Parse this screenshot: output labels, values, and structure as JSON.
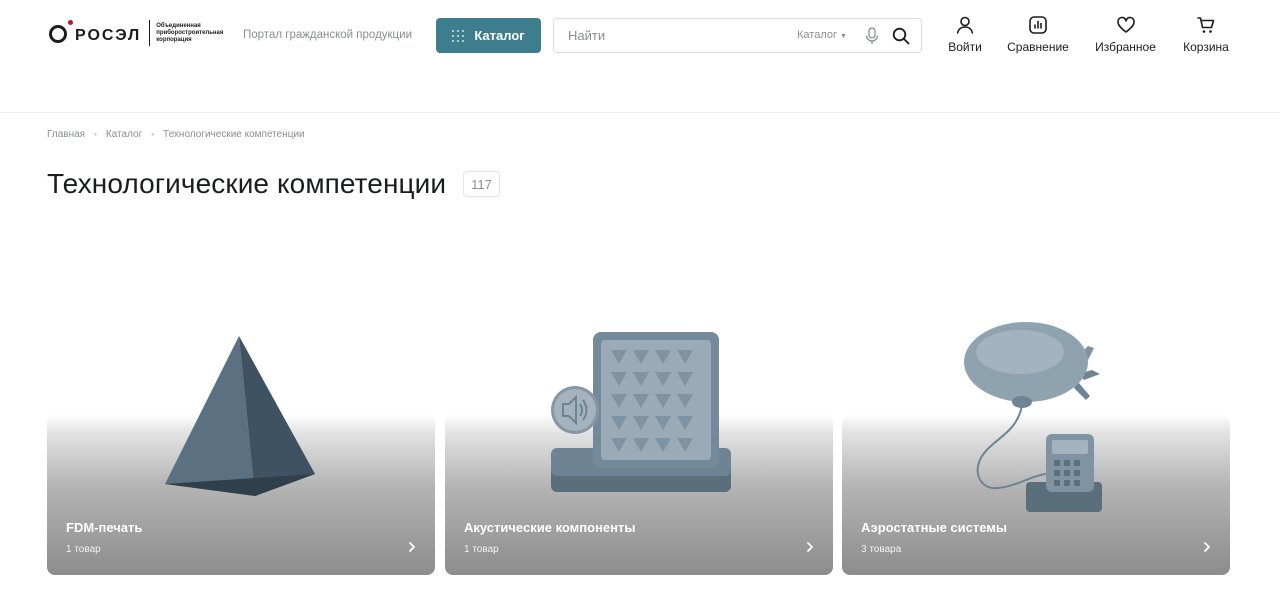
{
  "header": {
    "logo": {
      "wordmark": "РОСЭЛ",
      "tagline": "Объединенная приборостроительная корпорация"
    },
    "portal_label": "Портал гражданской продукции",
    "catalog_button": "Каталог",
    "search": {
      "placeholder": "Найти",
      "scope": "Каталог"
    },
    "actions": [
      {
        "label": "Войти",
        "icon": "user-icon"
      },
      {
        "label": "Сравнение",
        "icon": "compare-icon"
      },
      {
        "label": "Избранное",
        "icon": "heart-icon"
      },
      {
        "label": "Корзина",
        "icon": "cart-icon"
      }
    ]
  },
  "breadcrumb": [
    "Главная",
    "Каталог",
    "Технологические компетенции"
  ],
  "page": {
    "title": "Технологические компетенции",
    "count": "117"
  },
  "cards": [
    {
      "title": "FDM-печать",
      "count": "1 товар",
      "image": "pyramid"
    },
    {
      "title": "Акустические компоненты",
      "count": "1 товар",
      "image": "acoustic-panel"
    },
    {
      "title": "Аэростатные системы",
      "count": "3 товара",
      "image": "airship"
    }
  ],
  "colors": {
    "accent": "#3d7d8e",
    "text": "#1b1c1e",
    "muted": "#8a8d91",
    "model": "#6e8494"
  }
}
